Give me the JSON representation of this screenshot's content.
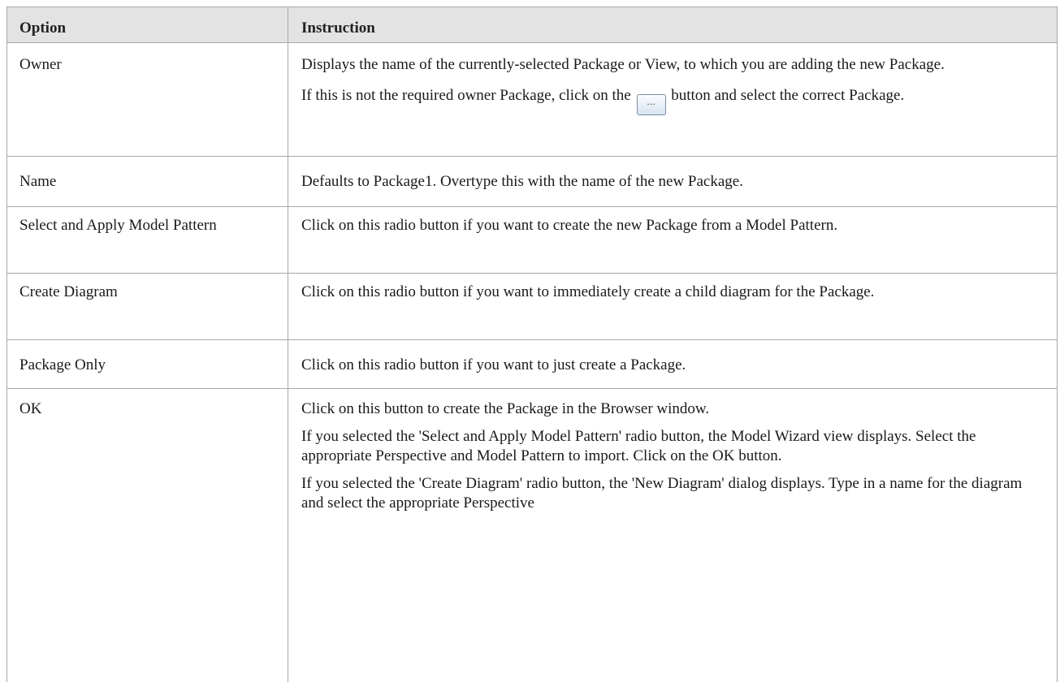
{
  "header": {
    "option": "Option",
    "instruction": "Instruction"
  },
  "rows": [
    {
      "option": "Owner",
      "p1": "Displays the name of the currently-selected Package or View, to which you are adding the new Package.",
      "p2a": "If this is not the required owner Package, click on the",
      "button_label": "...",
      "p2b": "button and select the correct Package."
    },
    {
      "option": "Name",
      "p1": "Defaults to Package1. Overtype this with the name of the new Package."
    },
    {
      "option": "Select and Apply Model Pattern",
      "p1": "Click on this radio button if you want to create the new Package from a Model Pattern."
    },
    {
      "option": "Create Diagram",
      "p1": "Click on this radio button if you want to immediately create a child diagram for the Package."
    },
    {
      "option": "Package Only",
      "p1": "Click on this radio button if you want to just create a Package."
    },
    {
      "option": "OK",
      "p1": "Click on this button to create the Package in the Browser window.",
      "p2": "If you selected the 'Select and Apply Model Pattern' radio button, the Model Wizard view displays. Select the appropriate Perspective and Model Pattern to import. Click on the OK button.",
      "p3": "If you selected the 'Create Diagram' radio button, the 'New Diagram' dialog displays. Type in a name for the diagram and select the appropriate Perspective"
    }
  ]
}
